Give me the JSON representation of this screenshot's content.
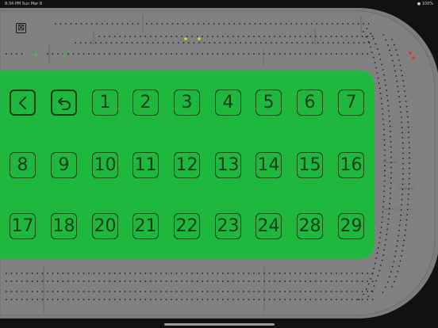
{
  "status_bar": {
    "time_date": "8:34 PM   Sun Mar 8",
    "indicators": "● 100%"
  },
  "close_button": {
    "label": "⊠"
  },
  "keypad": {
    "back_label": "back",
    "undo_label": "undo",
    "numbers": [
      [
        "1",
        "2",
        "3",
        "4",
        "5",
        "6",
        "7"
      ],
      [
        "8",
        "9",
        "10",
        "11",
        "12",
        "13",
        "14",
        "15",
        "16"
      ],
      [
        "17",
        "18",
        "20",
        "21",
        "22",
        "23",
        "24",
        "28",
        "29"
      ]
    ]
  },
  "pegs": [
    {
      "name": "yellow-peg-1",
      "color": "#f2d21a"
    },
    {
      "name": "yellow-peg-2",
      "color": "#f2d21a"
    },
    {
      "name": "green-peg-1",
      "color": "#2ecc40"
    },
    {
      "name": "green-peg-2",
      "color": "#2ecc40"
    },
    {
      "name": "red-peg-1",
      "color": "#e0302a"
    },
    {
      "name": "red-peg-2",
      "color": "#e0302a"
    }
  ],
  "colors": {
    "board": "#7d7d7d",
    "track_border": "#2a2a2a",
    "background": "#111111",
    "keypad_green": "#1eb83f",
    "key_outline": "#0e3d17"
  }
}
